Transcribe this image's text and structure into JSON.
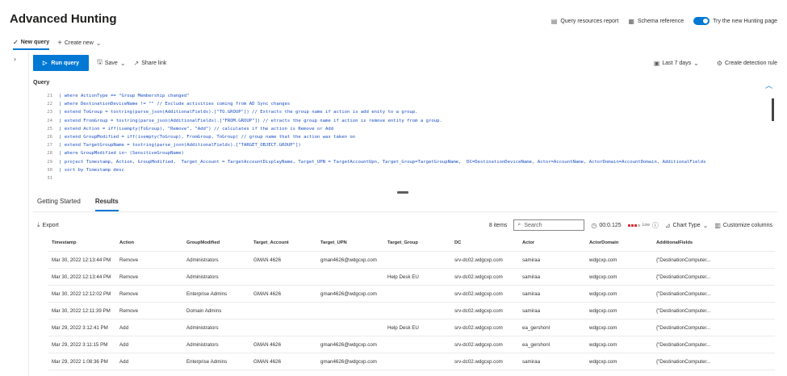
{
  "header": {
    "title": "Advanced Hunting"
  },
  "top_actions": {
    "query_resources": "Query resources report",
    "schema": "Schema reference",
    "try_new": "Try the new Hunting page"
  },
  "tabs": {
    "new_query": "New query",
    "create_new": "Create new"
  },
  "toolbar": {
    "run": "Run query",
    "save": "Save",
    "share": "Share link",
    "time_range": "Last 7 days",
    "create_rule": "Create detection rule"
  },
  "query": {
    "label": "Query",
    "lines": [
      {
        "n": "21",
        "text": "| where ActionType == \"Group Membership changed\""
      },
      {
        "n": "22",
        "text": "| where DestinationDeviceName != \"\" // Exclude activities coming from AD Sync changes"
      },
      {
        "n": "23",
        "text": "| extend ToGroup = tostring(parse_json(AdditionalFields).[\"TO.GROUP\"]) // Extracts the group name if action is add enity to a group."
      },
      {
        "n": "24",
        "text": "| extend FromGroup = tostring(parse_json(AdditionalFields).[\"FROM.GROUP\"]) // etracts the group name if action is remove entity from a group."
      },
      {
        "n": "25",
        "text": "| extend Action = iff(isempty(ToGroup), \"Remove\", \"Add\") // calculates if the action is Remove or Add"
      },
      {
        "n": "26",
        "text": "| extend GroupModified = iff(isempty(ToGroup), FromGroup, ToGroup) // group name that the action was taken on"
      },
      {
        "n": "27",
        "text": "| extend TargetGroupName = tostring(parse_json(AdditionalFields).[\"TARGET_OBJECT.GROUP\"])"
      },
      {
        "n": "28",
        "text": "| where GroupModified in~ (SensitiveGroupName)"
      },
      {
        "n": "29",
        "text": "| project Timestamp, Action, GroupModified,  Target_Account = TargetAccountDisplayName, Target_UPN = TargetAccountUpn, Target_Group=TargetGroupName,  DC=DestinationDeviceName, Actor=AccountName, ActorDomain=AccountDomain, AdditionalFields"
      },
      {
        "n": "30",
        "text": "| sort by Timestamp desc"
      },
      {
        "n": "31",
        "text": ""
      }
    ]
  },
  "results_tabs": {
    "getting_started": "Getting Started",
    "results": "Results"
  },
  "results_toolbar": {
    "export": "Export",
    "items": "8 items",
    "search_placeholder": "Search",
    "time": "00:0.125",
    "low": "Low",
    "chart_type": "Chart Type",
    "customize": "Customize columns"
  },
  "table": {
    "columns": [
      "Timestamp",
      "Action",
      "GroupModified",
      "Target_Account",
      "Target_UPN",
      "Target_Group",
      "DC",
      "Actor",
      "ActorDomain",
      "AdditionalFields"
    ],
    "rows": [
      [
        "Mar 30, 2022 12:13:44 PM",
        "Remove",
        "Administrators",
        "GMAN 4626",
        "gman4626@wdgcxp.com",
        "",
        "srv-dc02.wdgcxp.com",
        "samiraa",
        "wdgcxp.com",
        "{\"DestinationComputer..."
      ],
      [
        "Mar 30, 2022 12:13:44 PM",
        "Remove",
        "Administrators",
        "",
        "",
        "Help Desk EU",
        "srv-dc02.wdgcxp.com",
        "samiraa",
        "wdgcxp.com",
        "{\"DestinationComputer..."
      ],
      [
        "Mar 30, 2022 12:12:02 PM",
        "Remove",
        "Enterprise Admins",
        "GMAN 4626",
        "gman4626@wdgcxp.com",
        "",
        "srv-dc02.wdgcxp.com",
        "samiraa",
        "wdgcxp.com",
        "{\"DestinationComputer..."
      ],
      [
        "Mar 30, 2022 12:11:39 PM",
        "Remove",
        "Domain Admins",
        "",
        "",
        "",
        "srv-dc02.wdgcxp.com",
        "samiraa",
        "wdgcxp.com",
        "{\"DestinationComputer..."
      ],
      [
        "Mar 29, 2022 3:12:41 PM",
        "Add",
        "Administrators",
        "",
        "",
        "Help Desk EU",
        "srv-dc02.wdgcxp.com",
        "ea_gershonl",
        "wdgcxp.com",
        "{\"DestinationComputer..."
      ],
      [
        "Mar 29, 2022 3:11:15 PM",
        "Add",
        "Administrators",
        "GMAN 4626",
        "gman4626@wdgcxp.com",
        "",
        "srv-dc02.wdgcxp.com",
        "ea_gershonl",
        "wdgcxp.com",
        "{\"DestinationComputer..."
      ],
      [
        "Mar 29, 2022 1:08:36 PM",
        "Add",
        "Enterprise Admins",
        "GMAN 4626",
        "gman4626@wdgcxp.com",
        "",
        "srv-dc02.wdgcxp.com",
        "samiraa",
        "wdgcxp.com",
        "{\"DestinationComputer..."
      ]
    ]
  },
  "colors": {
    "accent": "#0078d4",
    "code": "#1b4ec4"
  },
  "icons": [
    "query-report-icon",
    "schema-icon",
    "toggle-icon",
    "plus-icon",
    "play-icon",
    "save-icon",
    "share-icon",
    "calendar-icon",
    "rule-icon",
    "chevron-up-icon",
    "export-icon",
    "search-icon",
    "timer-icon",
    "chart-icon",
    "columns-icon"
  ]
}
